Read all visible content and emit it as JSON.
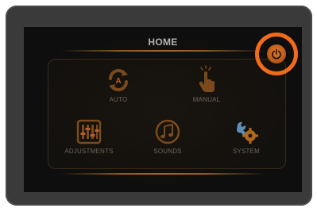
{
  "screen": {
    "title": "HOME"
  },
  "tiles": [
    {
      "label": "AUTO",
      "icon": "auto-cycle-icon"
    },
    {
      "label": "MANUAL",
      "icon": "tap-hand-icon"
    },
    {
      "label": "ADJUSTMENTS",
      "icon": "sliders-icon"
    },
    {
      "label": "SOUNDS",
      "icon": "music-note-icon"
    },
    {
      "label": "SYSTEM",
      "icon": "wrench-gear-icon"
    }
  ],
  "power": {
    "icon": "power-icon",
    "highlight_color": "#f26a1b"
  },
  "colors": {
    "accent": "#a0672a",
    "label": "#6e6357",
    "title": "#b3b3b3"
  }
}
